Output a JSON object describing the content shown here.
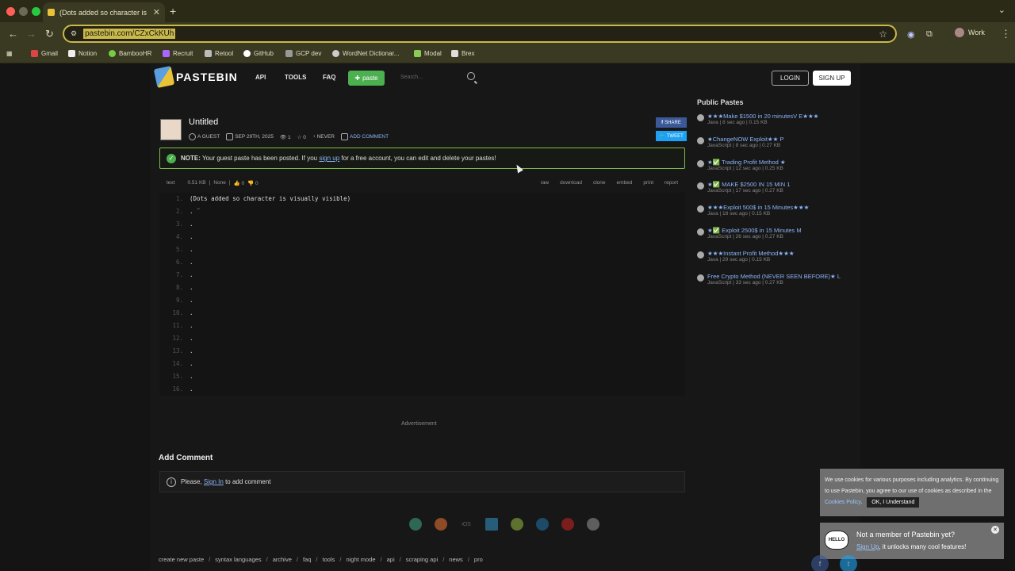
{
  "browser": {
    "tab_title": "(Dots added so character is ...",
    "url": "pastebin.com/CZxCkKUh",
    "profile": "Work",
    "bookmarks": [
      "Gmail",
      "Notion",
      "BambooHR",
      "Recruit",
      "Retool",
      "GitHub",
      "GCP dev",
      "WordNet Dictionar...",
      "Modal",
      "Brex"
    ]
  },
  "header": {
    "logo": "PASTEBIN",
    "nav": [
      "API",
      "TOOLS",
      "FAQ"
    ],
    "paste_btn": "paste",
    "search_placeholder": "Search...",
    "login": "LOGIN",
    "signup": "SIGN UP"
  },
  "paste": {
    "title": "Untitled",
    "author": "A GUEST",
    "date": "SEP 29TH, 2025",
    "views": "1",
    "stars": "0",
    "expire": "NEVER",
    "add_comment": "ADD COMMENT",
    "share": "SHARE",
    "tweet": "TWEET"
  },
  "notice": {
    "bold": "NOTE:",
    "text1": "Your guest paste has been posted. If you",
    "link": "sign up",
    "text2": "for a free account, you can edit and delete your pastes!"
  },
  "info": {
    "syntax": "text",
    "size": "0.51 KB",
    "sep": "|",
    "category": "None",
    "likes": "0",
    "dislikes": "0",
    "actions": [
      "raw",
      "download",
      "clone",
      "embed",
      "print",
      "report"
    ]
  },
  "code": {
    "line_numbers": [
      "1.",
      "2.",
      "3.",
      "4.",
      "5.",
      "6.",
      "7.",
      "8.",
      "9.",
      "10.",
      "11.",
      "12.",
      "13.",
      "14.",
      "15.",
      "16."
    ],
    "lines": [
      "(Dots added so character is visually visible)",
      ". ̈",
      ".",
      ".",
      ".",
      ".",
      ".",
      ".",
      ".",
      ".",
      ".",
      ".",
      ".",
      ".",
      ".",
      "."
    ]
  },
  "advertisement": "Advertisement",
  "add_comment": {
    "title": "Add Comment",
    "please": "Please,",
    "sign_in": "Sign In",
    "rest": "to add comment"
  },
  "footer_links": [
    "create new paste",
    "syntax languages",
    "archive",
    "faq",
    "tools",
    "night mode",
    "api",
    "scraping api",
    "news",
    "pro"
  ],
  "public_pastes": {
    "title": "Public Pastes",
    "items": [
      {
        "name": "★★★Make $1500 in 20 minutesV E★★★",
        "sub": "Java | 8 sec ago | 0.15 KB"
      },
      {
        "name": "★ChangeNOW Exploit★★ P",
        "sub": "JavaScript | 8 sec ago | 0.27 KB"
      },
      {
        "name": "★✅ Trading Profit Method ★",
        "sub": "JavaScript | 12 sec ago | 0.25 KB"
      },
      {
        "name": "★✅ MAKE $2500 IN 15 MIN 1",
        "sub": "JavaScript | 17 sec ago | 0.27 KB"
      },
      {
        "name": "★★★Exploit 500$ in 15 Minutes★★★",
        "sub": "Java | 18 sec ago | 0.15 KB"
      },
      {
        "name": "★✅ Exploit 2500$ in 15 Minutes M",
        "sub": "JavaScript | 26 sec ago | 0.27 KB"
      },
      {
        "name": "★★★Instant Profit Method★★★",
        "sub": "Java | 29 sec ago | 0.15 KB"
      },
      {
        "name": "Free Crypto Method (NEVER SEEN BEFORE)★ L",
        "sub": "JavaScript | 33 sec ago | 0.27 KB"
      }
    ]
  },
  "cookie": {
    "text": "We use cookies for various purposes including analytics. By continuing to use Pastebin, you agree to our use of cookies as described in the",
    "link": "Cookies Policy",
    "btn": "OK, I Understand"
  },
  "member": {
    "hello": "HELLO",
    "title": "Not a member of Pastebin yet?",
    "link": "Sign Up",
    "rest": ", it unlocks many cool features!"
  },
  "apps": [
    "",
    "",
    "iOS",
    "",
    "",
    "",
    "",
    ""
  ]
}
